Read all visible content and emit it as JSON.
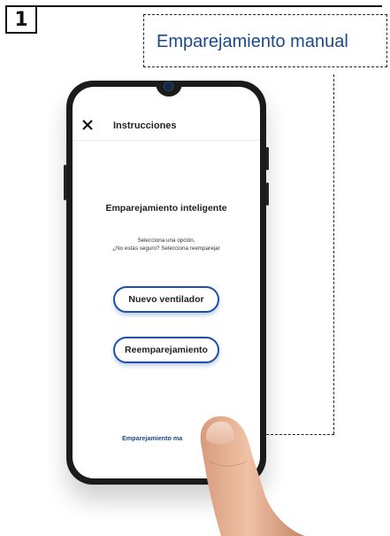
{
  "step": {
    "number": "1"
  },
  "callout": {
    "title": "Emparejamiento manual"
  },
  "phone": {
    "header": {
      "title": "Instrucciones",
      "close_icon": "close-icon"
    },
    "smart_pairing": {
      "title": "Emparejamiento inteligente",
      "subtitle_line1": "Selecciona una opción,",
      "subtitle_line2": "¿No estás seguro? Selecciona reemparejar"
    },
    "buttons": {
      "new_fan": "Nuevo ventilador",
      "repair": "Reemparejamiento"
    },
    "manual_link": "Emparejamiento ma"
  },
  "colors": {
    "accent": "#1f4fa6",
    "callout_text": "#1a4a8a"
  }
}
